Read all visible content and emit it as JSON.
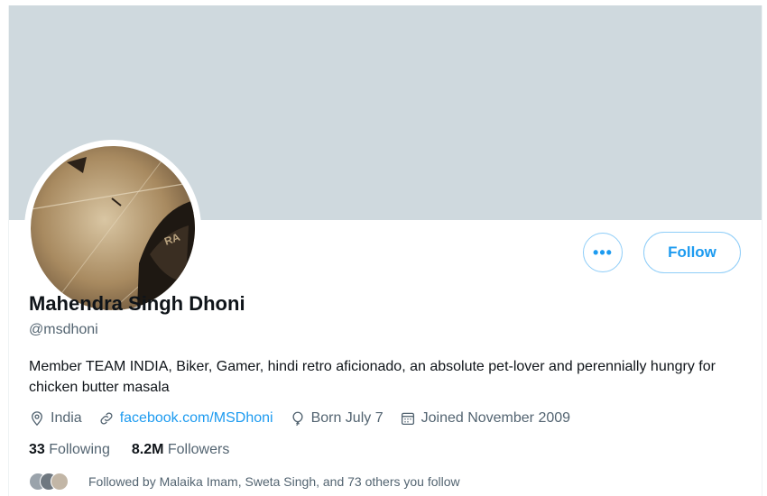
{
  "profile": {
    "name": "Mahendra Singh Dhoni",
    "handle": "@msdhoni",
    "bio": "Member TEAM INDIA, Biker, Gamer, hindi retro aficionado, an absolute pet-lover and perennially hungry for chicken butter masala",
    "location": "India",
    "website": "facebook.com/MSDhoni",
    "birthday": "Born July 7",
    "joined": "Joined November 2009"
  },
  "actions": {
    "more_label": "•••",
    "follow_label": "Follow"
  },
  "stats": {
    "following_count": "33",
    "following_label": "Following",
    "followers_count": "8.2M",
    "followers_label": "Followers"
  },
  "followed_by": "Followed by Malaika Imam, Sweta Singh, and 73 others you follow",
  "icons": {
    "location": "location-pin-icon",
    "website": "link-icon",
    "birthday": "balloon-icon",
    "joined": "calendar-icon",
    "more": "more-horizontal-icon"
  },
  "colors": {
    "accent": "#1d9bf0",
    "banner": "#cfd9de",
    "secondary_text": "#536471",
    "primary_text": "#0f1419"
  }
}
